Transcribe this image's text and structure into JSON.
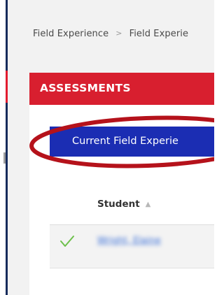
{
  "breadcrumb": {
    "items": [
      "Field Experience",
      "Field Experie"
    ],
    "separator": ">"
  },
  "assessments": {
    "title": "ASSESSMENTS",
    "header_color": "#d81f2f"
  },
  "tabs": {
    "current_label": "Current Field Experie",
    "current_color": "#1b2db3"
  },
  "annotation": {
    "color": "#b5121b"
  },
  "table": {
    "columns": [
      {
        "label": "Student",
        "sort_indicator": "▲"
      }
    ],
    "rows": [
      {
        "status_icon": "check-icon",
        "student_name": "Wright, Elaine"
      }
    ]
  }
}
